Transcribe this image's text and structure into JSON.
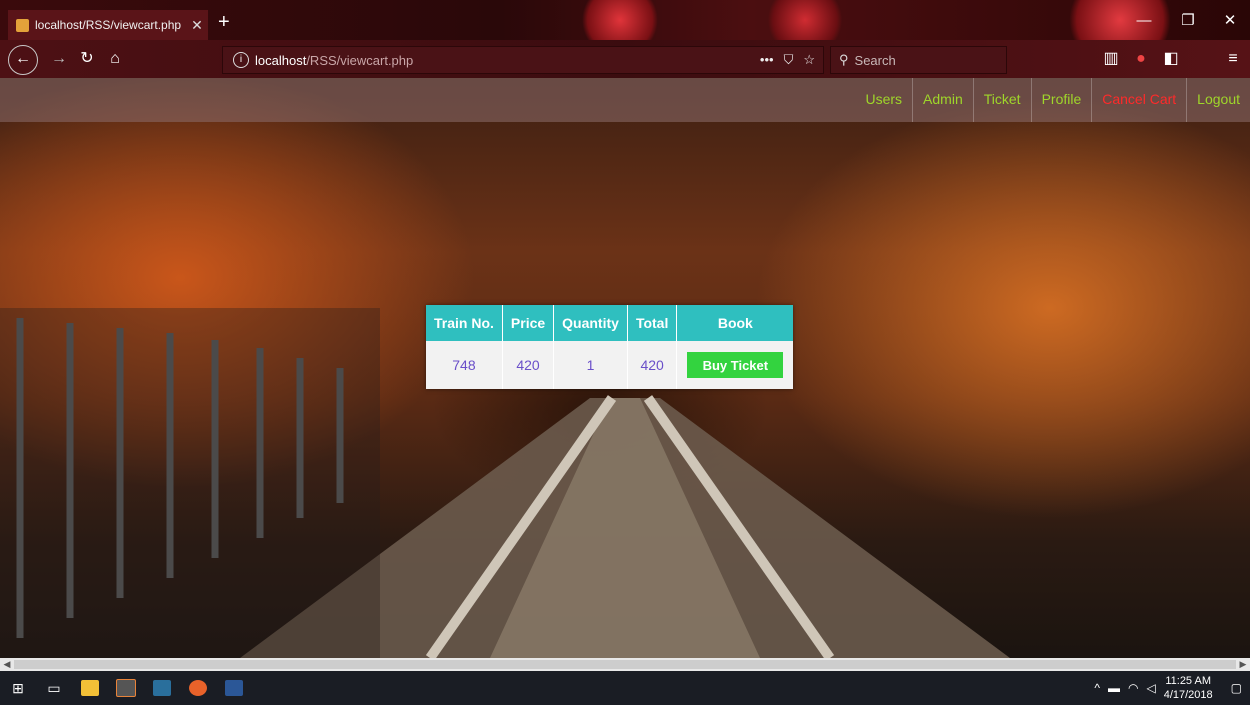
{
  "browser": {
    "tab_title": "localhost/RSS/viewcart.php",
    "url_host": "localhost",
    "url_path": "/RSS/viewcart.php",
    "search_placeholder": "Search",
    "url_more": "•••",
    "new_tab": "+"
  },
  "nav": {
    "items": [
      {
        "label": "Users",
        "color": "#9fd62a"
      },
      {
        "label": "Admin",
        "color": "#9fd62a"
      },
      {
        "label": "Ticket",
        "color": "#9fd62a"
      },
      {
        "label": "Profile",
        "color": "#9fd62a"
      },
      {
        "label": "Cancel Cart",
        "color": "#ff2a2a"
      },
      {
        "label": "Logout",
        "color": "#9fd62a"
      }
    ]
  },
  "cart": {
    "headers": [
      "Train No.",
      "Price",
      "Quantity",
      "Total",
      "Book"
    ],
    "rows": [
      {
        "train_no": "748",
        "price": "420",
        "quantity": "1",
        "total": "420",
        "action": "Buy Ticket"
      }
    ],
    "header_color": "#2fbfbf",
    "button_color": "#33d33f",
    "value_color": "#6a4fc9"
  },
  "taskbar": {
    "time": "11:25 AM",
    "date": "4/17/2018"
  }
}
